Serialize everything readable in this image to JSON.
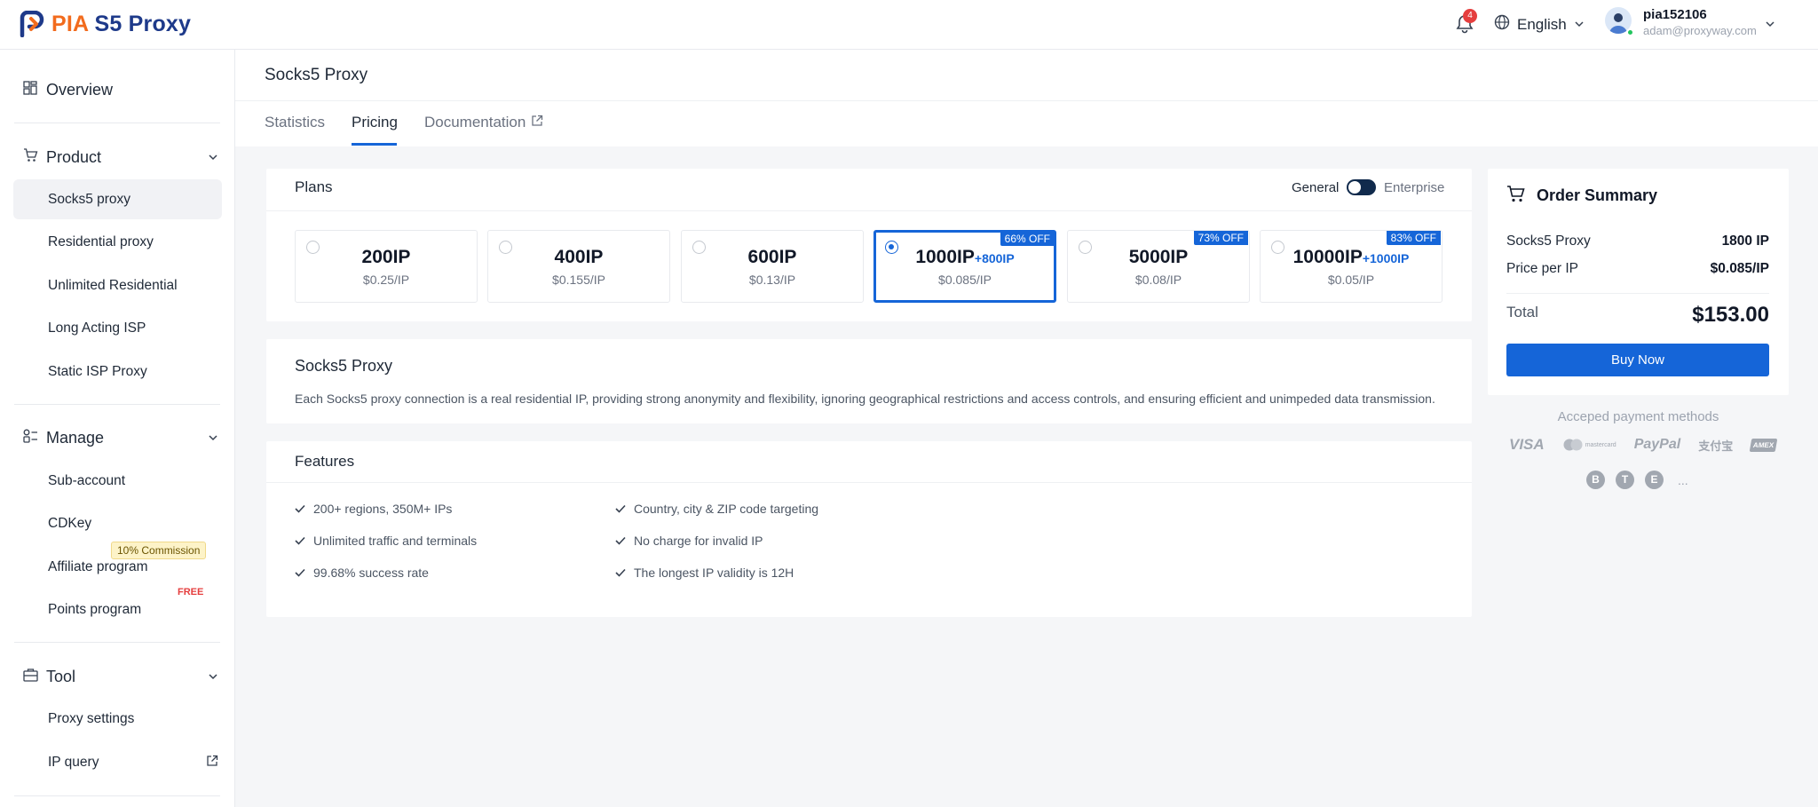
{
  "header": {
    "logo_pia": "PIA",
    "logo_s5": "S5 Proxy",
    "notification_count": "4",
    "language": "English",
    "user_name": "pia152106",
    "user_email": "adam@proxyway.com"
  },
  "sidebar": {
    "overview": "Overview",
    "product": {
      "label": "Product",
      "items": [
        "Socks5 proxy",
        "Residential proxy",
        "Unlimited Residential",
        "Long Acting ISP",
        "Static ISP Proxy"
      ]
    },
    "manage": {
      "label": "Manage",
      "items": [
        "Sub-account",
        "CDKey",
        "Affiliate program",
        "Points program"
      ],
      "commission_badge": "10% Commission",
      "free_badge": "FREE"
    },
    "tool": {
      "label": "Tool",
      "items": [
        "Proxy settings",
        "IP query"
      ]
    }
  },
  "main": {
    "title": "Socks5 Proxy",
    "tabs": [
      "Statistics",
      "Pricing",
      "Documentation"
    ],
    "plans_title": "Plans",
    "toggle_general": "General",
    "toggle_enterprise": "Enterprise",
    "plans": [
      {
        "name": "200IP",
        "bonus": "",
        "price": "$0.25/IP",
        "off": ""
      },
      {
        "name": "400IP",
        "bonus": "",
        "price": "$0.155/IP",
        "off": ""
      },
      {
        "name": "600IP",
        "bonus": "",
        "price": "$0.13/IP",
        "off": ""
      },
      {
        "name": "1000IP",
        "bonus": "+800IP",
        "price": "$0.085/IP",
        "off": "66% OFF"
      },
      {
        "name": "5000IP",
        "bonus": "",
        "price": "$0.08/IP",
        "off": "73% OFF"
      },
      {
        "name": "10000IP",
        "bonus": "+1000IP",
        "price": "$0.05/IP",
        "off": "83% OFF"
      }
    ],
    "description_title": "Socks5 Proxy",
    "description": "Each Socks5 proxy connection is a real residential IP, providing strong anonymity and flexibility, ignoring geographical restrictions and access controls, and ensuring efficient and unimpeded data transmission.",
    "features_title": "Features",
    "features": [
      "200+ regions, 350M+ IPs",
      "Unlimited traffic and terminals",
      "99.68% success rate",
      "Country, city & ZIP code targeting",
      "No charge for invalid IP",
      "The longest IP validity is 12H"
    ]
  },
  "order": {
    "title": "Order Summary",
    "product_label": "Socks5 Proxy",
    "product_value": "1800 IP",
    "price_label": "Price per IP",
    "price_value": "$0.085/IP",
    "total_label": "Total",
    "total_value": "$153.00",
    "buy_label": "Buy Now",
    "payment_label": "Acceped payment methods",
    "payment_logos": [
      "VISA",
      "mastercard",
      "PayPal",
      "支付宝",
      "AMEX"
    ],
    "coins": [
      "B",
      "T",
      "E"
    ],
    "more": "..."
  },
  "colors": {
    "accent": "#1565d8",
    "logo_orange": "#f26b1d",
    "logo_navy": "#1e3a8a",
    "commission_bg": "#fdf3c8",
    "free_red": "#e53e3e"
  }
}
